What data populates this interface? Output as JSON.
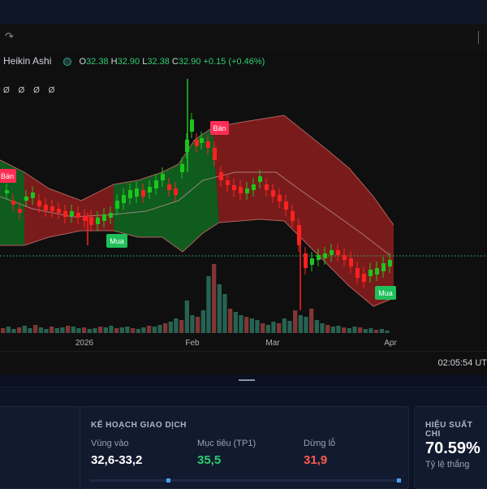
{
  "legend": {
    "name": "Heikin Ashi",
    "open_key": "O",
    "open": "32.38",
    "high_key": "H",
    "high": "32.90",
    "low_key": "L",
    "low": "32.38",
    "close_key": "C",
    "close": "32.90",
    "change": "+0.15 (+0.46%)"
  },
  "indicator_row": "Ø Ø Ø Ø",
  "signals": {
    "sell": "Bán",
    "buy": "Mua"
  },
  "x_axis": {
    "labels": [
      "2026",
      "Feb",
      "Mar",
      "Apr"
    ]
  },
  "clock": "02:05:54 UT",
  "plan": {
    "title": "KẾ HOẠCH GIAO DỊCH",
    "entry_label": "Vùng vào",
    "entry_value": "32,6-33,2",
    "target_label": "Mục tiêu (TP1)",
    "target_value": "35,5",
    "stop_label": "Dừng lỗ",
    "stop_value": "31,9"
  },
  "performance": {
    "title": "HIỆU SUẤT CHI",
    "win_rate": "70.59%",
    "win_rate_label": "Tỷ lệ thắng"
  },
  "colors": {
    "up": "#1ec41e",
    "down": "#ff2020",
    "band_bull": "#0f5c1e",
    "band_bear": "#7a1b1b",
    "sell_badge": "#ff2d55",
    "buy_badge": "#1fbf5a",
    "target": "#2ecc71",
    "stop": "#ff5a4f"
  },
  "icons": {
    "toolbar": "redo-icon"
  }
}
